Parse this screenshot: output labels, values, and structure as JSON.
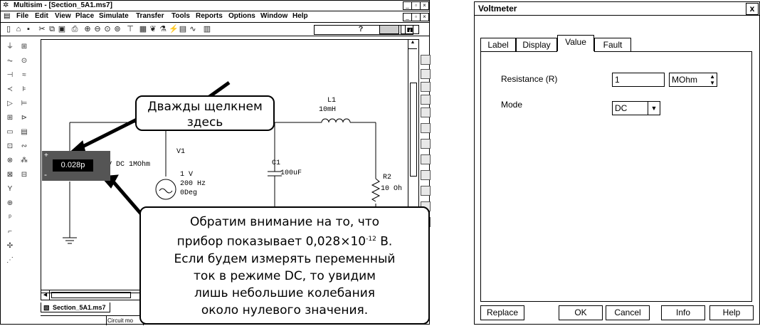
{
  "multisim": {
    "title": "Multisim - [Section_5A1.ms7]",
    "menu": [
      "File",
      "Edit",
      "View",
      "Place",
      "Simulate",
      "Transfer",
      "Tools",
      "Reports",
      "Options",
      "Window",
      "Help"
    ],
    "toolbar_help": "?",
    "document_tab": "Section_5A1.ms7",
    "status_cell": "Circuit mo"
  },
  "schematic": {
    "L1_name": "L1",
    "L1_value": "10mH",
    "V1_name": "V1",
    "V1_line1": "1 V",
    "V1_line2": "200 Hz",
    "V1_line3": "0Deg",
    "C1_name": "C1",
    "C1_value": "100uF",
    "R2_name": "R2",
    "R2_value": "10 Oh",
    "meter_reading": "0.028p",
    "meter_mode": "V  DC   1MOhm",
    "meter_plus": "+",
    "meter_minus": "-"
  },
  "callouts": {
    "top_line1": "Дважды щелкнем",
    "top_line2": "здесь",
    "bottom_line1": "Обратим внимание на то, что",
    "bottom_line2_a": "прибор показывает 0,028×10",
    "bottom_line2_sup": "-12",
    "bottom_line2_b": " В.",
    "bottom_line3": "Если будем измерять переменный",
    "bottom_line4": "ток в режиме DC, то увидим",
    "bottom_line5": "лишь небольшие колебания",
    "bottom_line6": "около нулевого значения."
  },
  "dialog": {
    "title": "Voltmeter",
    "close": "x",
    "tabs": [
      "Label",
      "Display",
      "Value",
      "Fault"
    ],
    "active_tab": "Value",
    "resistance_label": "Resistance (R)",
    "resistance_value": "1",
    "resistance_unit": "MOhm",
    "mode_label": "Mode",
    "mode_value": "DC",
    "buttons": {
      "replace": "Replace",
      "ok": "OK",
      "cancel": "Cancel",
      "info": "Info",
      "help": "Help"
    }
  }
}
